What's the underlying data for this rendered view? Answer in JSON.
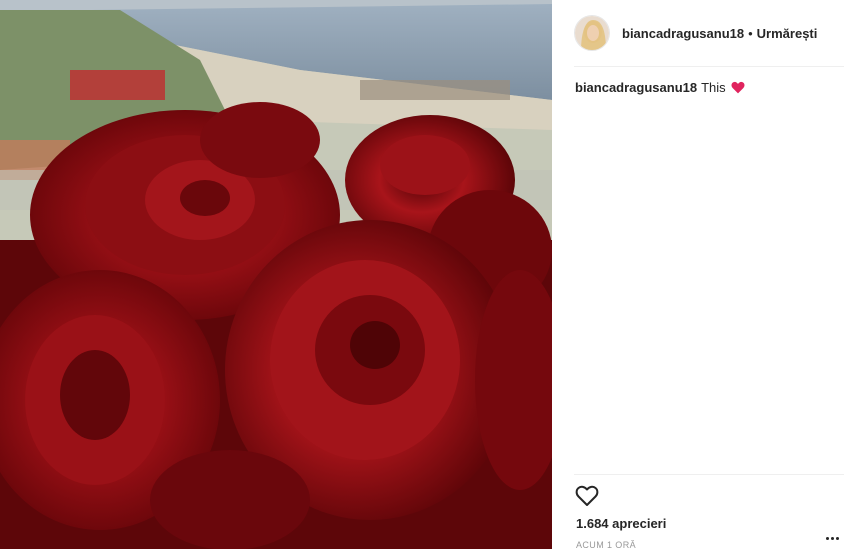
{
  "post": {
    "username": "biancadragusanu18",
    "separator": "•",
    "follow_label": "Urmărești",
    "caption_text": "This",
    "caption_emoji_icon": "red-heart-icon",
    "likes": "1.684 aprecieri",
    "timestamp": "ACUM 1 ORĂ"
  },
  "icons": {
    "like": "heart-outline-icon",
    "more": "more-options-icon"
  },
  "colors": {
    "heart_red": "#e0245e",
    "border": "#efefef",
    "text": "#262626",
    "muted": "#999999"
  }
}
